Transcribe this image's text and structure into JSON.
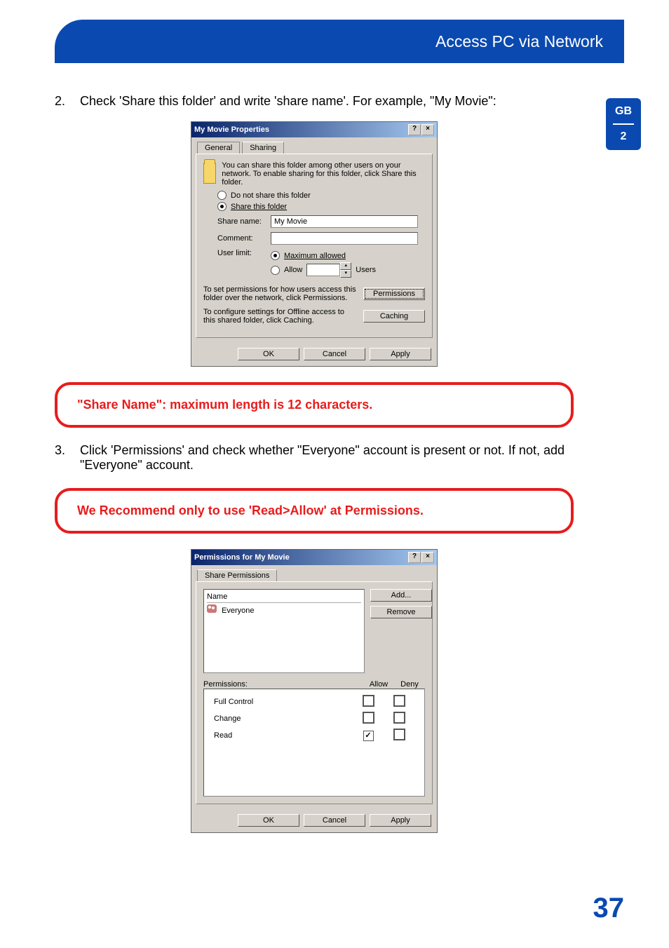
{
  "header": {
    "title": "Access PC via Network"
  },
  "side_tab": {
    "lang": "GB",
    "section": "2"
  },
  "steps": {
    "s2": {
      "num": "2.",
      "text": "Check 'Share this folder' and write 'share name'. For example, \"My Movie\":"
    },
    "s3": {
      "num": "3.",
      "text": "Click 'Permissions' and check whether \"Everyone\" account is present or not. If not, add \"Everyone\" account."
    }
  },
  "callout1": "\"Share Name\": maximum length is 12 characters.",
  "callout2": "We Recommend only to use 'Read>Allow' at Permissions.",
  "dialog1": {
    "title": "My Movie Properties",
    "help_btn": "?",
    "close_btn": "×",
    "tab_general": "General",
    "tab_sharing": "Sharing",
    "intro": "You can share this folder among other users on your network.  To enable sharing for this folder, click Share this folder.",
    "opt_no_share": "Do not share this folder",
    "opt_share": "Share this folder",
    "share_name_label": "Share name:",
    "share_name_value": "My Movie",
    "comment_label": "Comment:",
    "comment_value": "",
    "user_limit_label": "User limit:",
    "opt_max": "Maximum allowed",
    "opt_allow": "Allow",
    "users_suffix": "Users",
    "perm_text": "To set permissions for how users access this folder over the network, click Permissions.",
    "perm_btn": "Permissions",
    "cache_text": "To configure settings for Offline access to this shared folder, click Caching.",
    "cache_btn": "Caching",
    "ok": "OK",
    "cancel": "Cancel",
    "apply": "Apply"
  },
  "dialog2": {
    "title": "Permissions for My Movie",
    "help_btn": "?",
    "close_btn": "×",
    "tab": "Share Permissions",
    "name_col": "Name",
    "entry": "Everyone",
    "add_btn": "Add...",
    "remove_btn": "Remove",
    "perm_label": "Permissions:",
    "allow": "Allow",
    "deny": "Deny",
    "rows": {
      "full": "Full Control",
      "change": "Change",
      "read": "Read"
    },
    "ok": "OK",
    "cancel": "Cancel",
    "apply": "Apply"
  },
  "page_number": "37"
}
